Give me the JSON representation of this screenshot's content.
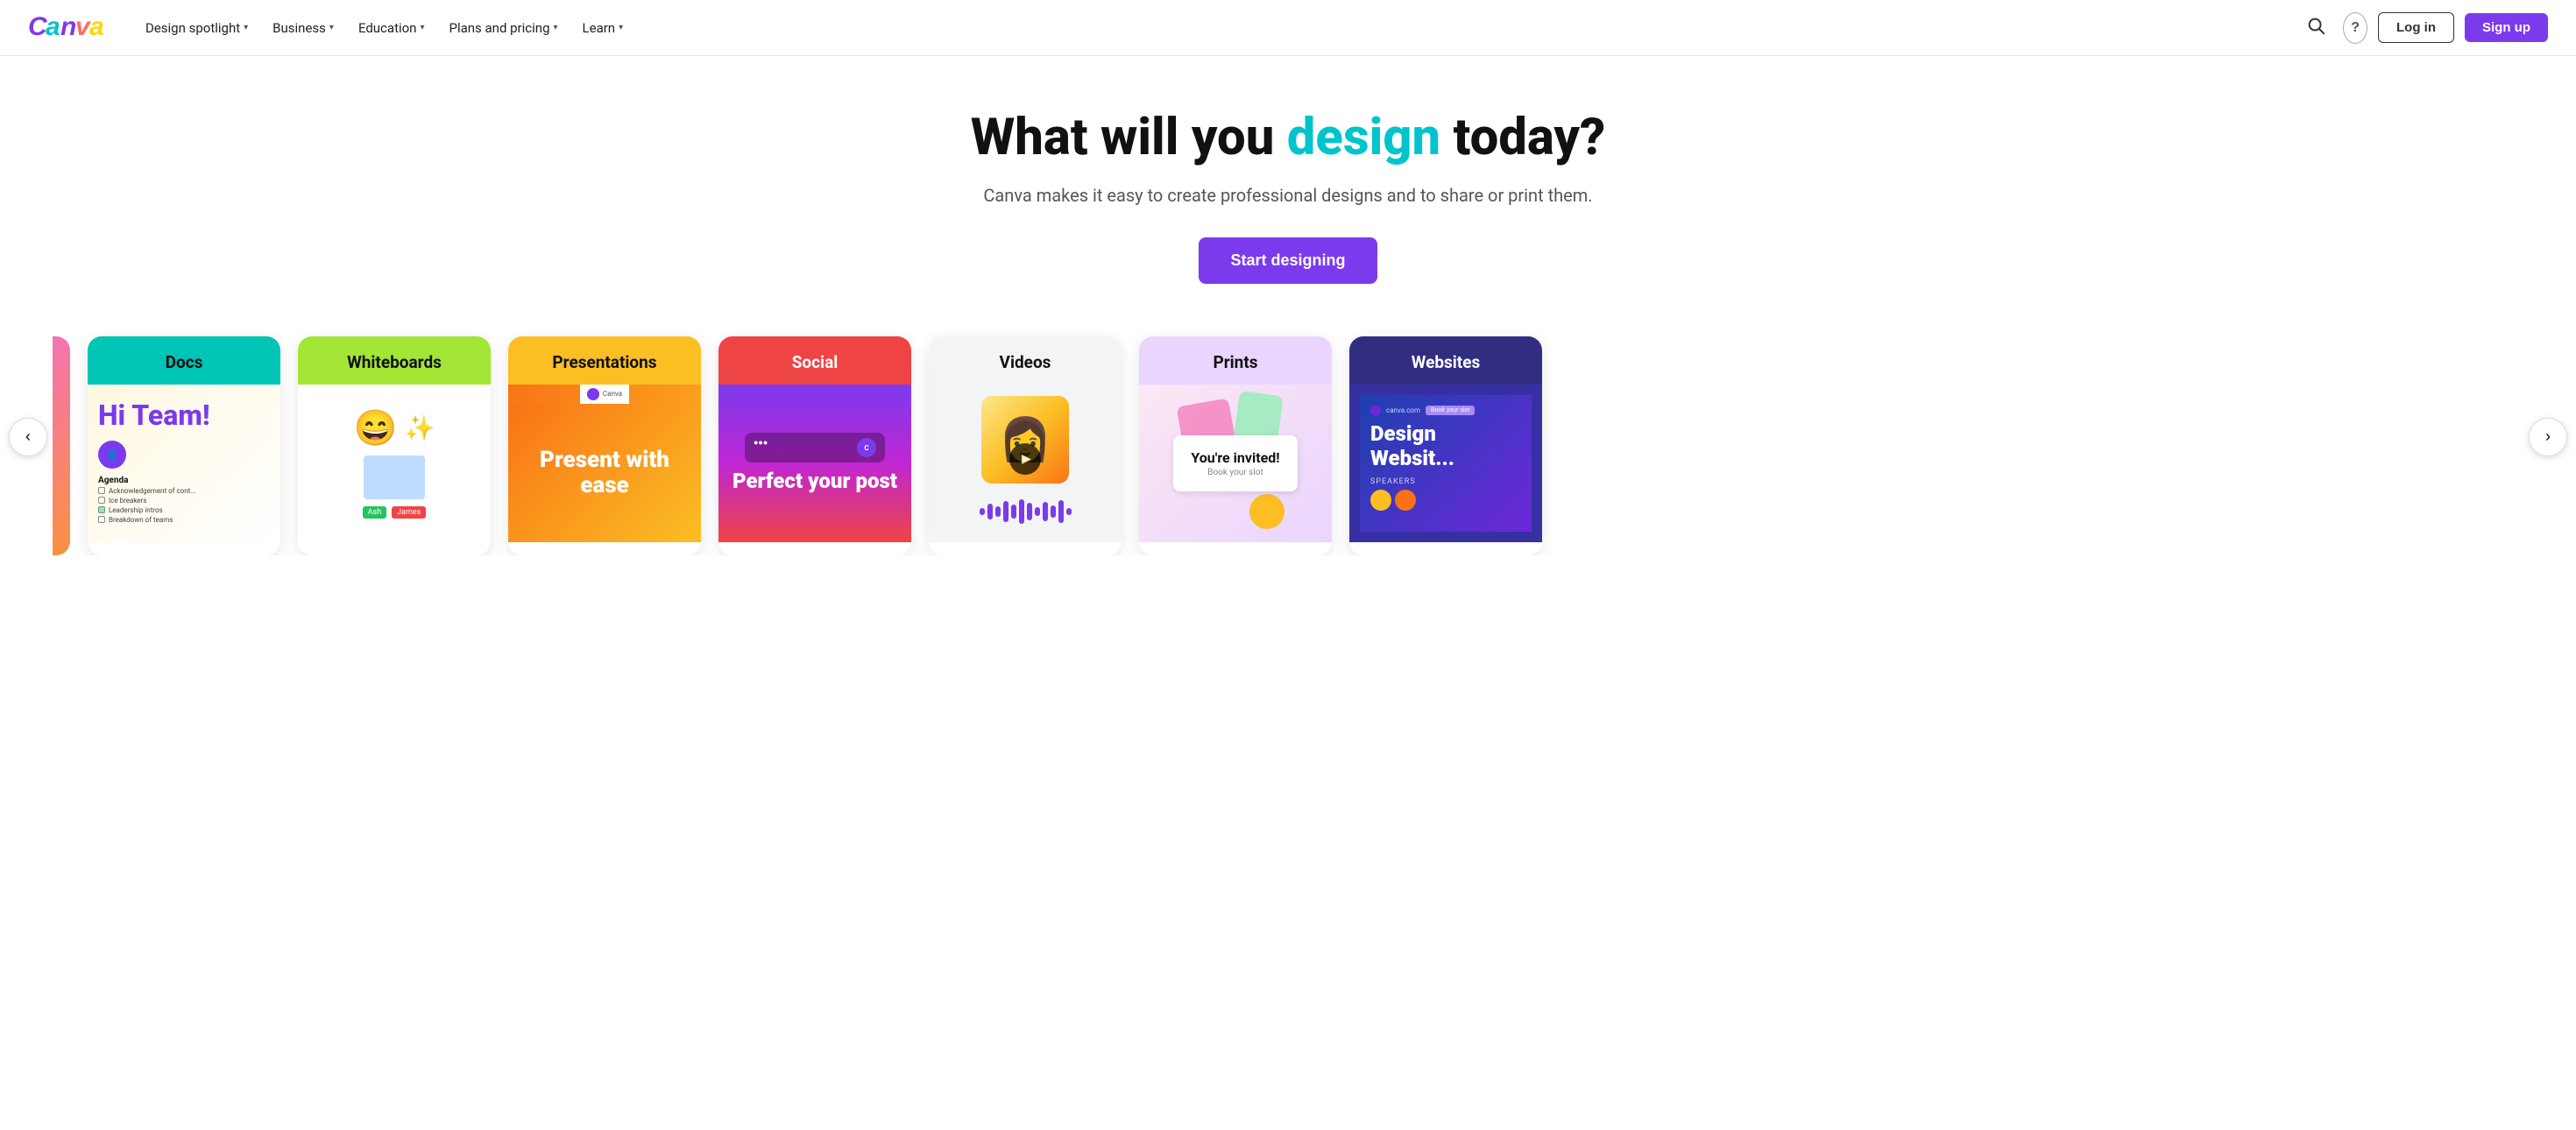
{
  "brand": {
    "name": "Canva",
    "logo_text": "Canva"
  },
  "nav": {
    "links": [
      {
        "label": "Design spotlight",
        "id": "design-spotlight"
      },
      {
        "label": "Business",
        "id": "business"
      },
      {
        "label": "Education",
        "id": "education"
      },
      {
        "label": "Plans and pricing",
        "id": "plans-and-pricing"
      },
      {
        "label": "Learn",
        "id": "learn"
      }
    ],
    "login_label": "Log in",
    "signup_label": "Sign up",
    "search_icon": "🔍",
    "help_icon": "?"
  },
  "hero": {
    "title_part1": "What will you ",
    "title_highlight": "design",
    "title_part2": " today?",
    "subtitle": "Canva makes it easy to create professional designs and to share or print them.",
    "cta_label": "Start designing"
  },
  "cards": [
    {
      "id": "docs",
      "label": "Docs",
      "bg_header": "#00c4b4",
      "header_color": "#111",
      "content_type": "docs"
    },
    {
      "id": "whiteboards",
      "label": "Whiteboards",
      "bg_header": "#a3e635",
      "header_color": "#111",
      "content_type": "whiteboards"
    },
    {
      "id": "presentations",
      "label": "Presentations",
      "bg_header": "#fbbf24",
      "header_color": "#111",
      "content_type": "presentations",
      "preview_text": "Present with ease"
    },
    {
      "id": "social",
      "label": "Social",
      "bg_header": "#ef4444",
      "header_color": "#fff",
      "content_type": "social",
      "preview_text": "Perfect your post"
    },
    {
      "id": "videos",
      "label": "Videos",
      "bg_header": "#f3f4f6",
      "header_color": "#111",
      "content_type": "videos"
    },
    {
      "id": "prints",
      "label": "Prints",
      "bg_header": "#e9d5ff",
      "header_color": "#111",
      "content_type": "prints",
      "invite_text": "You're invited!",
      "invite_sub": "Book your slot"
    },
    {
      "id": "websites",
      "label": "Websites",
      "bg_header": "#312e81",
      "header_color": "#fff",
      "content_type": "websites",
      "preview_title": "Design Websit...",
      "speakers_label": "SPEAKERS"
    }
  ],
  "carousel": {
    "prev_label": "‹",
    "next_label": "›"
  },
  "docs_card": {
    "greeting": "Hi Team!",
    "agenda_label": "Agenda",
    "items": [
      "Acknowledgement of cont...",
      "Ice breakers",
      "Leadership intros",
      "Breakdown of teams"
    ]
  }
}
